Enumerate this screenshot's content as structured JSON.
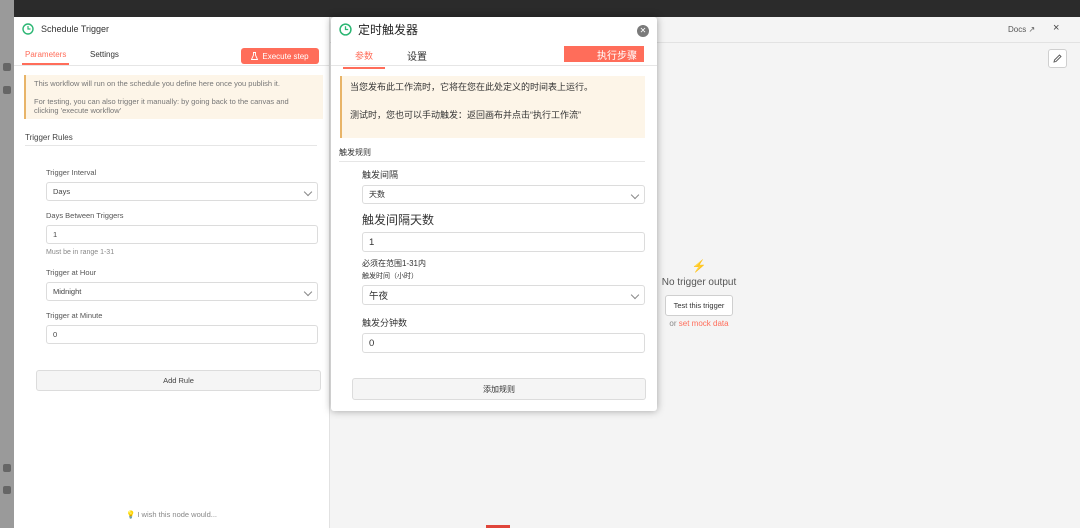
{
  "node": {
    "title": "Schedule Trigger",
    "tabs": {
      "parameters": "Parameters",
      "settings": "Settings"
    },
    "execute_step": "Execute step",
    "notice": {
      "line1": "This workflow will run on the schedule you define here once you publish it.",
      "line2": "For testing, you can also trigger it manually: by going back to the canvas and clicking 'execute workflow'"
    },
    "section_title": "Trigger Rules",
    "fields": {
      "interval_label": "Trigger Interval",
      "interval_value": "Days",
      "days_label": "Days Between Triggers",
      "days_value": "1",
      "days_hint": "Must be in range 1-31",
      "hour_label": "Trigger at Hour",
      "hour_value": "Midnight",
      "minute_label": "Trigger at Minute",
      "minute_value": "0"
    },
    "add_rule": "Add Rule",
    "feedback": "I wish this node would..."
  },
  "header_right": {
    "docs": "Docs",
    "close": "×"
  },
  "output": {
    "empty_title": "No trigger output",
    "test_button": "Test this trigger",
    "or_text": "or",
    "mock_link": "set mock data"
  },
  "translation": {
    "title": "定时触发器",
    "tabs": {
      "parameters": "参数",
      "settings": "设置"
    },
    "execute_step": "执行步骤",
    "notice": {
      "line1": "当您发布此工作流时，它将在您在此处定义的时间表上运行。",
      "line2": "测试时，您也可以手动触发：返回画布并点击“执行工作流”"
    },
    "section_title": "触发规则",
    "fields": {
      "interval_label": "触发间隔",
      "interval_value": "天数",
      "days_label": "触发间隔天数",
      "days_value": "1",
      "days_hint": "必须在范围1-31内",
      "hour_label": "触发时间（小时）",
      "hour_value": "午夜",
      "minute_label": "触发分钟数",
      "minute_value": "0"
    },
    "add_rule": "添加规则"
  },
  "colors": {
    "accent": "#ff6d5a",
    "trigger_green": "#2bb673",
    "notice_bg": "#fdf5e8"
  }
}
